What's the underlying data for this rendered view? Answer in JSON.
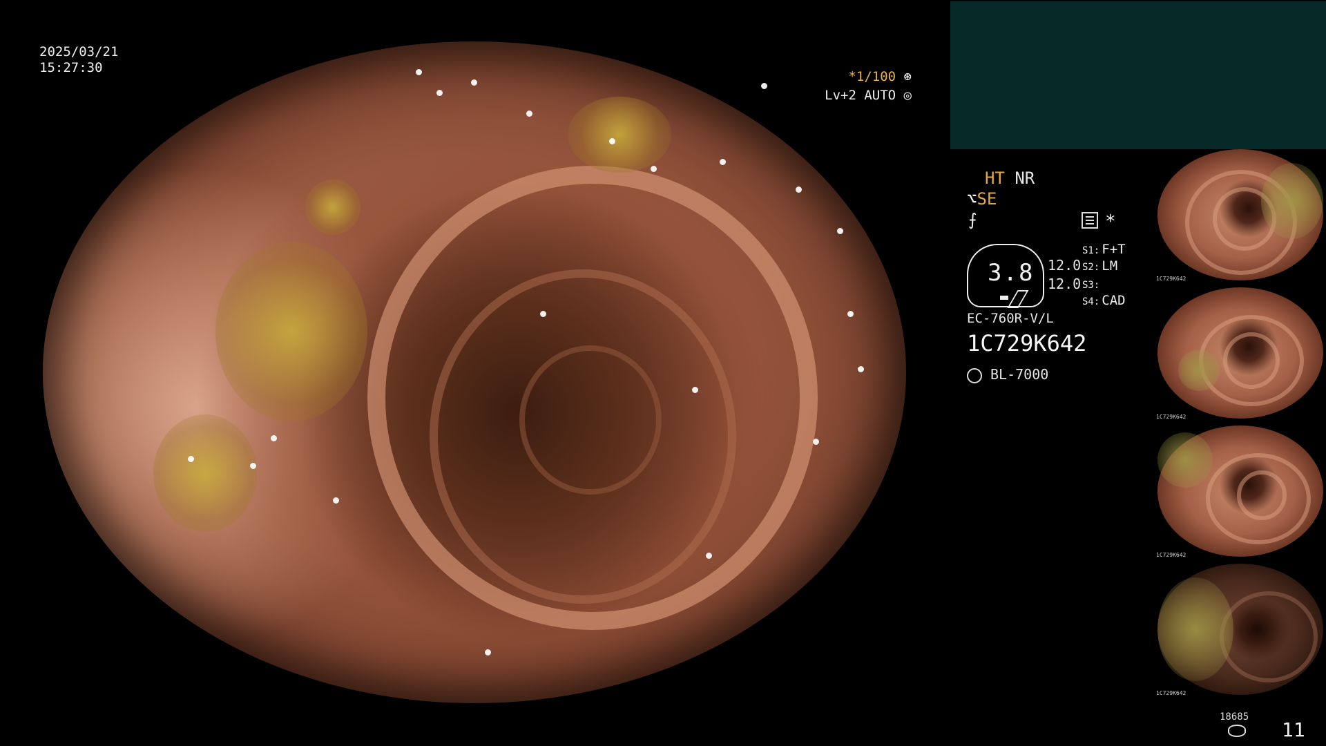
{
  "overlay": {
    "date": "2025/03/21",
    "time": "15:27:30",
    "shutter": "*1/100",
    "level": "Lv+2 AUTO"
  },
  "panel": {
    "ht": "HT",
    "nr": "NR",
    "se": "SE",
    "zoom": "3.8",
    "value_a": "12.0",
    "value_b": "12.0",
    "switches": [
      {
        "key": "S1:",
        "value": "F+T"
      },
      {
        "key": "S2:",
        "value": "LM"
      },
      {
        "key": "S3:",
        "value": ""
      },
      {
        "key": "S4:",
        "value": "CAD"
      }
    ],
    "model": "EC-760R-V/L",
    "serial": "1C729K642",
    "light_source": "BL-7000"
  },
  "thumbnails": [
    {
      "caption": "1C729K642"
    },
    {
      "caption": "1C729K642"
    },
    {
      "caption": "1C729K642"
    },
    {
      "caption": "1C729K642"
    }
  ],
  "footer": {
    "count": "18685",
    "page": "11"
  },
  "colors": {
    "accent": "#e8a93a",
    "teal_box": "#062a27",
    "background": "#000000"
  },
  "icons": [
    "aperture-icon",
    "iris-icon",
    "scope-icon",
    "f-icon",
    "list-icon",
    "asterisk-icon",
    "light-source-icon",
    "disk-icon"
  ]
}
